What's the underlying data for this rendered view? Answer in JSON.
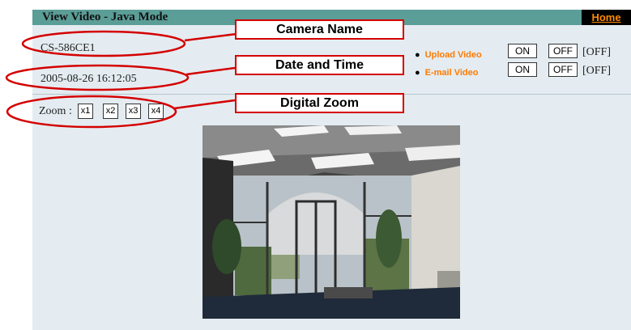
{
  "header": {
    "title": "View Video - Java Mode",
    "home_label": "Home"
  },
  "camera": {
    "name": "CS-586CE1",
    "datetime": "2005-08-26 16:12:05"
  },
  "zoom": {
    "label": "Zoom :",
    "buttons": [
      "x1",
      "x2",
      "x3",
      "x4"
    ]
  },
  "options": [
    {
      "label": "Upload Video",
      "on_label": "ON",
      "off_label": "OFF",
      "state": "[OFF]"
    },
    {
      "label": "E-mail Video",
      "on_label": "ON",
      "off_label": "OFF",
      "state": "[OFF]"
    }
  ],
  "annotations": {
    "camera_name": "Camera Name",
    "date_time": "Date and Time",
    "digital_zoom": "Digital Zoom"
  },
  "colors": {
    "title_bar": "#5b9d97",
    "panel": "#e4ecf1",
    "accent_orange": "#ff7a00",
    "annotation_red": "#d40000"
  },
  "video": {
    "alt": "live camera view"
  }
}
